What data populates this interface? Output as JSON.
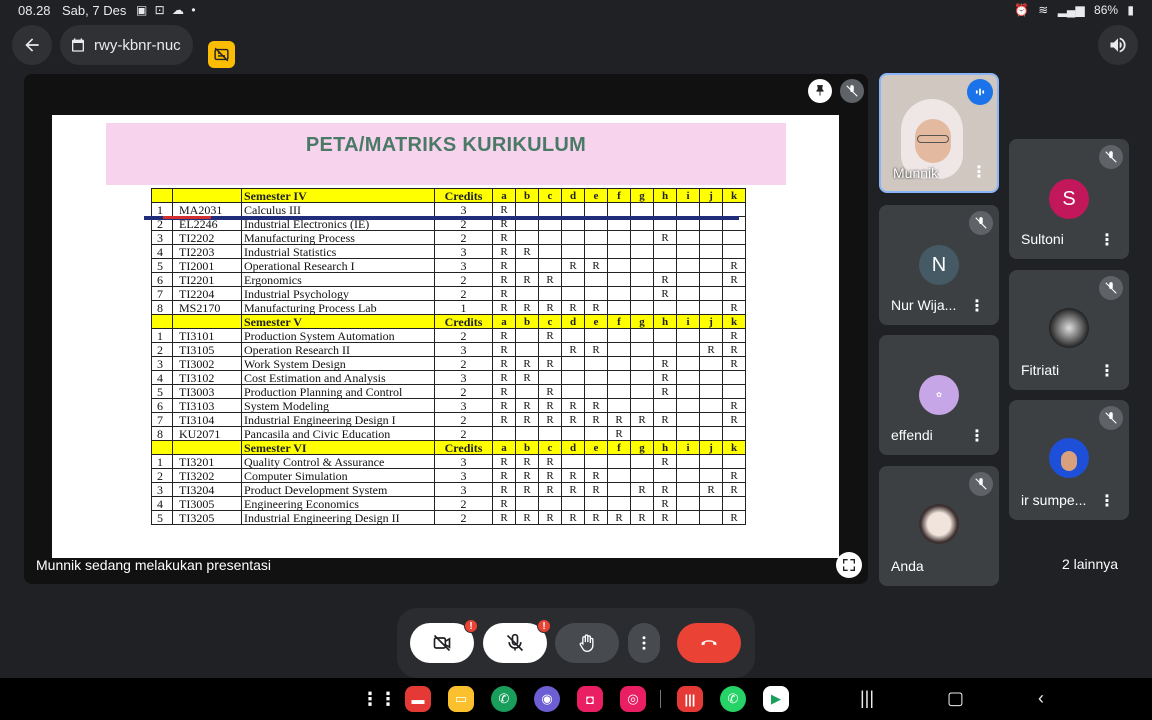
{
  "status": {
    "time": "08.28",
    "date": "Sab, 7 Des",
    "battery": "86%"
  },
  "header": {
    "meeting_code": "rwy-kbnr-nuc"
  },
  "slide": {
    "title": "PETA/MATRIKS KURIKULUM",
    "columns": [
      "Credits",
      "a",
      "b",
      "c",
      "d",
      "e",
      "f",
      "g",
      "h",
      "i",
      "j",
      "k"
    ],
    "semesters": [
      {
        "label": "Semester IV",
        "rows": [
          {
            "no": "1",
            "code": "MA2031",
            "course": "Calculus III",
            "credits": "3",
            "marks": [
              "R",
              "",
              "",
              "",
              "",
              "",
              "",
              "",
              "",
              "",
              ""
            ]
          },
          {
            "no": "2",
            "code": "EL2246",
            "course": "Industrial Electronics (IE)",
            "credits": "2",
            "marks": [
              "R",
              "",
              "",
              "",
              "",
              "",
              "",
              "",
              "",
              "",
              ""
            ]
          },
          {
            "no": "3",
            "code": "TI2202",
            "course": "Manufacturing Process",
            "credits": "2",
            "marks": [
              "R",
              "",
              "",
              "",
              "",
              "",
              "",
              "R",
              "",
              "",
              ""
            ]
          },
          {
            "no": "4",
            "code": "TI2203",
            "course": "Industrial Statistics",
            "credits": "3",
            "marks": [
              "R",
              "R",
              "",
              "",
              "",
              "",
              "",
              "",
              "",
              "",
              ""
            ]
          },
          {
            "no": "5",
            "code": "TI2001",
            "course": "Operational Research I",
            "credits": "3",
            "marks": [
              "R",
              "",
              "",
              "R",
              "R",
              "",
              "",
              "",
              "",
              "",
              "R"
            ]
          },
          {
            "no": "6",
            "code": "TI2201",
            "course": "Ergonomics",
            "credits": "2",
            "marks": [
              "R",
              "R",
              "R",
              "",
              "",
              "",
              "",
              "R",
              "",
              "",
              "R"
            ]
          },
          {
            "no": "7",
            "code": "TI2204",
            "course": "Industrial Psychology",
            "credits": "2",
            "marks": [
              "R",
              "",
              "",
              "",
              "",
              "",
              "",
              "R",
              "",
              "",
              ""
            ]
          },
          {
            "no": "8",
            "code": "MS2170",
            "course": "Manufacturing Process Lab",
            "credits": "1",
            "marks": [
              "R",
              "R",
              "R",
              "R",
              "R",
              "",
              "",
              "",
              "",
              "",
              "R"
            ]
          }
        ]
      },
      {
        "label": "Semester V",
        "rows": [
          {
            "no": "1",
            "code": "TI3101",
            "course": "Production System Automation",
            "credits": "2",
            "marks": [
              "R",
              "",
              "R",
              "",
              "",
              "",
              "",
              "",
              "",
              "",
              "R"
            ]
          },
          {
            "no": "2",
            "code": "TI3105",
            "course": "Operation Research II",
            "credits": "3",
            "marks": [
              "R",
              "",
              "",
              "R",
              "R",
              "",
              "",
              "",
              "",
              "R",
              "R"
            ]
          },
          {
            "no": "3",
            "code": "TI3002",
            "course": "Work System Design",
            "credits": "2",
            "marks": [
              "R",
              "R",
              "R",
              "",
              "",
              "",
              "",
              "R",
              "",
              "",
              "R"
            ]
          },
          {
            "no": "4",
            "code": "TI3102",
            "course": "Cost Estimation and Analysis",
            "credits": "3",
            "marks": [
              "R",
              "R",
              "",
              "",
              "",
              "",
              "",
              "R",
              "",
              "",
              ""
            ]
          },
          {
            "no": "5",
            "code": "TI3003",
            "course": "Production Planning and Control",
            "credits": "2",
            "marks": [
              "R",
              "",
              "R",
              "",
              "",
              "",
              "",
              "R",
              "",
              "",
              ""
            ]
          },
          {
            "no": "6",
            "code": "TI3103",
            "course": "System Modeling",
            "credits": "3",
            "marks": [
              "R",
              "R",
              "R",
              "R",
              "R",
              "",
              "",
              "",
              "",
              "",
              "R"
            ]
          },
          {
            "no": "7",
            "code": "TI3104",
            "course": "Industrial Engineering Design I",
            "credits": "2",
            "marks": [
              "R",
              "R",
              "R",
              "R",
              "R",
              "R",
              "R",
              "R",
              "",
              "",
              "R"
            ]
          },
          {
            "no": "8",
            "code": "KU2071",
            "course": "Pancasila and Civic Education",
            "credits": "2",
            "marks": [
              "",
              "",
              "",
              "",
              "",
              "R",
              "",
              "",
              "",
              "",
              ""
            ]
          }
        ]
      },
      {
        "label": "Semester VI",
        "rows": [
          {
            "no": "1",
            "code": "TI3201",
            "course": "Quality Control & Assurance",
            "credits": "3",
            "marks": [
              "R",
              "R",
              "R",
              "",
              "",
              "",
              "",
              "R",
              "",
              "",
              ""
            ]
          },
          {
            "no": "2",
            "code": "TI3202",
            "course": "Computer Simulation",
            "credits": "3",
            "marks": [
              "R",
              "R",
              "R",
              "R",
              "R",
              "",
              "",
              "",
              "",
              "",
              "R"
            ]
          },
          {
            "no": "3",
            "code": "TI3204",
            "course": "Product Development System",
            "credits": "3",
            "marks": [
              "R",
              "R",
              "R",
              "R",
              "R",
              "",
              "R",
              "R",
              "",
              "R",
              "R"
            ]
          },
          {
            "no": "4",
            "code": "TI3005",
            "course": "Engineering Economics",
            "credits": "2",
            "marks": [
              "R",
              "",
              "",
              "",
              "",
              "",
              "",
              "R",
              "",
              "",
              ""
            ]
          },
          {
            "no": "5",
            "code": "TI3205",
            "course": "Industrial Engineering Design II",
            "credits": "2",
            "marks": [
              "R",
              "R",
              "R",
              "R",
              "R",
              "R",
              "R",
              "R",
              "",
              "",
              "R"
            ]
          }
        ]
      }
    ]
  },
  "presenting_text": "Munnik sedang melakukan presentasi",
  "participants": [
    {
      "name": "Munnik"
    },
    {
      "name": "Sultoni",
      "initial": "S",
      "color": "#c2185b"
    },
    {
      "name": "Nur Wija...",
      "initial": "N",
      "color": "#455a64"
    },
    {
      "name": "Fitriati"
    },
    {
      "name": "effendi"
    },
    {
      "name": "ir sumpe..."
    },
    {
      "name": "Anda"
    }
  ],
  "others_label": "2 lainnya",
  "colors": {
    "header_yellow": "#ffff00",
    "title_band": "#f8d3ee",
    "end_call": "#ea4335",
    "speaking": "#1a73e8"
  }
}
